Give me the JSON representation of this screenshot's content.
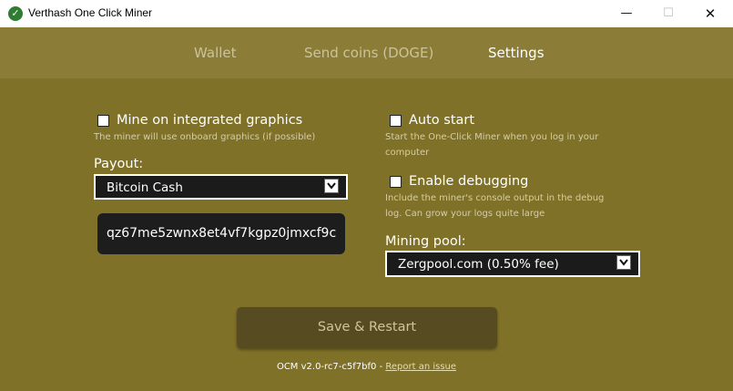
{
  "window": {
    "title": "Verthash One Click Miner",
    "minimize": "—",
    "maximize": "☐",
    "close": "✕"
  },
  "tabs": [
    {
      "label": "Wallet",
      "active": false
    },
    {
      "label": "Send coins (DOGE)",
      "active": false
    },
    {
      "label": "Settings",
      "active": true
    }
  ],
  "settings": {
    "integrated_graphics": {
      "label": "Mine on integrated graphics",
      "hint": "The miner will use onboard graphics (if possible)",
      "checked": false
    },
    "payout": {
      "label": "Payout:",
      "selected": "Bitcoin Cash",
      "address": "qz67me5zwnx8et4vf7kgpz0jmxcf9c"
    },
    "auto_start": {
      "label": "Auto start",
      "hint_line1": "Start the One-Click Miner when you log in your",
      "hint_line2": "computer",
      "checked": false
    },
    "debugging": {
      "label": "Enable debugging",
      "hint_line1": "Include the miner's console output in the debug",
      "hint_line2": "log. Can grow your logs quite large",
      "checked": false
    },
    "mining_pool": {
      "label": "Mining pool:",
      "selected": "Zergpool.com (0.50% fee)"
    },
    "save_label": "Save & Restart"
  },
  "footer": {
    "version": "OCM v2.0-rc7-c5f7bf0",
    "separator": " - ",
    "report_link": "Report an issue"
  },
  "colors": {
    "background": "#807128",
    "tabbar": "#8b7d38",
    "button": "#574b22",
    "select_bg": "#1b1b1b"
  }
}
